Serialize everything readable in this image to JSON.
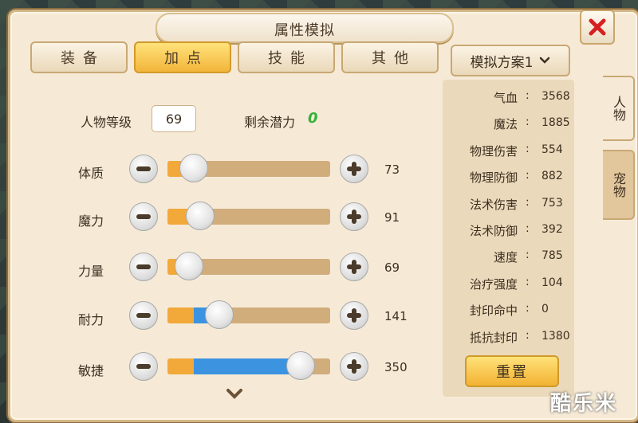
{
  "window": {
    "title": "属性模拟"
  },
  "tabs": [
    {
      "label": "装备",
      "active": false
    },
    {
      "label": "加点",
      "active": true
    },
    {
      "label": "技能",
      "active": false
    },
    {
      "label": "其他",
      "active": false
    }
  ],
  "level": {
    "label": "人物等级",
    "value": "69"
  },
  "potential": {
    "label": "剩余潜力",
    "value": "0"
  },
  "stats": [
    {
      "label": "体质",
      "value": "73",
      "orange": 0.1,
      "blue": 0.0,
      "knob": 0.16
    },
    {
      "label": "魔力",
      "value": "91",
      "orange": 0.13,
      "blue": 0.0,
      "knob": 0.2
    },
    {
      "label": "力量",
      "value": "69",
      "orange": 0.1,
      "blue": 0.0,
      "knob": 0.13
    },
    {
      "label": "耐力",
      "value": "141",
      "orange": 0.16,
      "blue": 0.16,
      "knob": 0.32
    },
    {
      "label": "敏捷",
      "value": "350",
      "orange": 0.16,
      "blue": 0.64,
      "knob": 0.82
    }
  ],
  "plan": {
    "label": "模拟方案1"
  },
  "attributes": [
    {
      "name": "气血",
      "value": "3568"
    },
    {
      "name": "魔法",
      "value": "1885"
    },
    {
      "name": "物理伤害",
      "value": "554"
    },
    {
      "name": "物理防御",
      "value": "882"
    },
    {
      "name": "法术伤害",
      "value": "753"
    },
    {
      "name": "法术防御",
      "value": "392"
    },
    {
      "name": "速度",
      "value": "785"
    },
    {
      "name": "治疗强度",
      "value": "104"
    },
    {
      "name": "封印命中",
      "value": "0"
    },
    {
      "name": "抵抗封印",
      "value": "1380"
    }
  ],
  "reset_label": "重置",
  "side_tabs": [
    {
      "label": "人物",
      "active": true
    },
    {
      "label": "宠物",
      "active": false
    }
  ],
  "watermark": "酷乐米",
  "colors": {
    "accent": "#f3b53b",
    "potential": "#35b13a",
    "bar_blue": "#3c93e0",
    "bar_orange": "#f3a83a"
  },
  "icons": {
    "close": "close-x-icon",
    "plan_dropdown": "chevron-down-icon",
    "scroll": "chevron-down-icon"
  }
}
